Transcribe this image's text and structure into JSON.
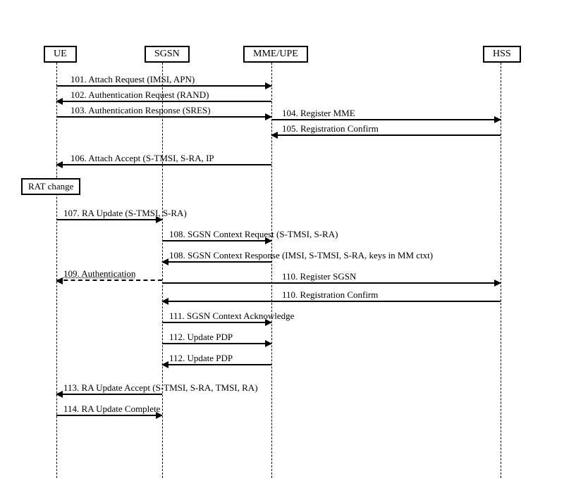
{
  "actors": {
    "ue": "UE",
    "sgsn": "SGSN",
    "mme": "MME/UPE",
    "hss": "HSS"
  },
  "rat_change_label": "RAT change",
  "messages": {
    "m101": "101. Attach Request (IMSI, APN)",
    "m102": "102. Authentication Request (RAND)",
    "m103": "103. Authentication Response (SRES)",
    "m104": "104. Register MME",
    "m105": "105. Registration Confirm",
    "m106": "106. Attach Accept (S-TMSI, S-RA, IP",
    "m107": "107. RA Update (S-TMSI, S-RA)",
    "m108a": "108. SGSN Context Request (S-TMSI, S-RA)",
    "m108b": "108. SGSN Context Response (IMSI, S-TMSI, S-RA, keys in MM ctxt)",
    "m109": "109. Authentication",
    "m110a": "110. Register SGSN",
    "m110b": "110. Registration Confirm",
    "m111": "111. SGSN Context Acknowledge",
    "m112a": "112. Update PDP",
    "m112b": "112. Update PDP",
    "m113": "113. RA Update Accept (S-TMSI, S-RA, TMSI, RA)",
    "m114": "114. RA Update Complete"
  }
}
